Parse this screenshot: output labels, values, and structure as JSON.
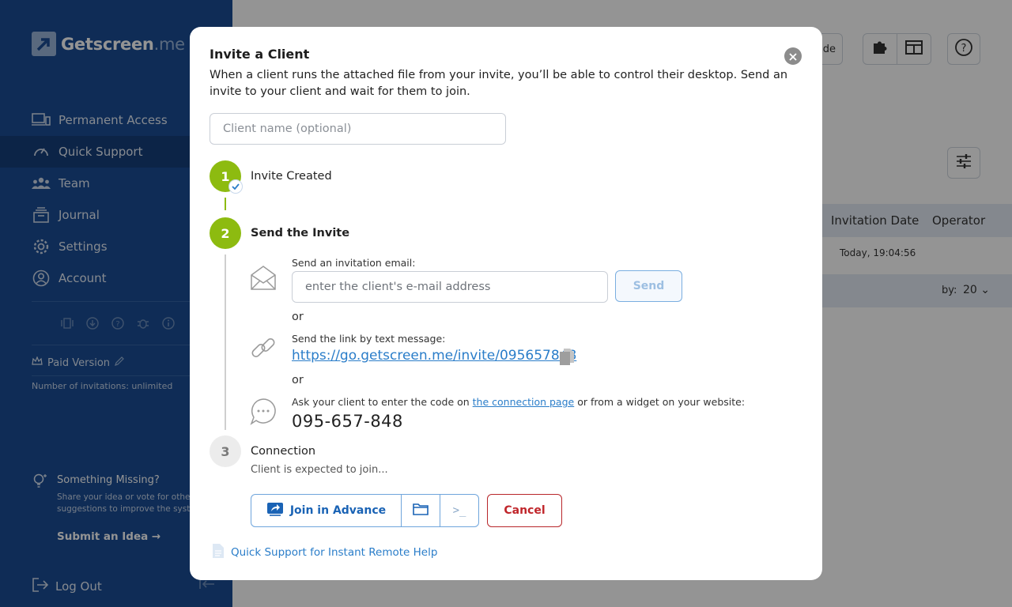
{
  "app": {
    "logo_main": "Getscreen",
    "logo_suffix": ".me"
  },
  "sidebar": {
    "items": [
      {
        "label": "Permanent Access",
        "icon": "devices-icon"
      },
      {
        "label": "Quick Support",
        "icon": "gauge-icon"
      },
      {
        "label": "Team",
        "icon": "team-icon"
      },
      {
        "label": "Journal",
        "icon": "journal-icon"
      },
      {
        "label": "Settings",
        "icon": "gear-icon"
      },
      {
        "label": "Account",
        "icon": "user-icon"
      }
    ],
    "paid_version": "Paid Version",
    "invites_count": "Number of invitations: unlimited",
    "missing_title": "Something Missing?",
    "missing_desc": "Share your idea or vote for other feature suggestions to improve the system.",
    "submit_idea": "Submit an Idea →",
    "logout": "Log Out"
  },
  "main": {
    "top_partial_label": "de",
    "table_headers": {
      "invitation_date": "Invitation Date",
      "operator": "Operator"
    },
    "row": {
      "date": "Today, 19:04:56"
    },
    "per_page_label": "by:",
    "per_page_value": "20"
  },
  "modal": {
    "title": "Invite a Client",
    "description": "When a client runs the attached file from your invite, you’ll be able to control their desktop. Send an invite to your client and wait for them to join.",
    "client_placeholder": "Client name (optional)",
    "steps": [
      {
        "num": "1",
        "label": "Invite Created"
      },
      {
        "num": "2",
        "label": "Send the Invite"
      },
      {
        "num": "3",
        "label": "Connection"
      }
    ],
    "email_label": "Send an invitation email:",
    "email_placeholder": "enter the client's e-mail address",
    "send": "Send",
    "or": "or",
    "sms_label": "Send the link by text message:",
    "invite_link": "https://go.getscreen.me/invite/095657848",
    "code_label_before": "Ask your client to enter the code on ",
    "code_label_link": "the connection page",
    "code_label_after": " or from a widget on your website:",
    "code": "095-657-848",
    "expected": "Client is expected to join...",
    "join_advance": "Join in Advance",
    "terminal": ">_",
    "cancel": "Cancel",
    "help_link": "Quick Support for Instant Remote Help"
  },
  "colors": {
    "sidebar": "#1a4d94",
    "accent_green": "#8dbb10",
    "link_blue": "#2a7dc9",
    "cancel_red": "#c0262b"
  }
}
